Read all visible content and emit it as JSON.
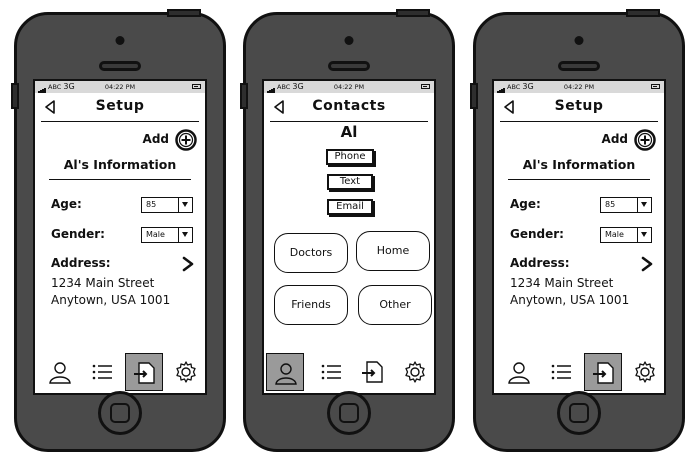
{
  "status": {
    "carrier": "ABC",
    "network": "3G",
    "time": "04:22 PM"
  },
  "setup": {
    "title": "Setup",
    "add_label": "Add",
    "section_title": "Al's Information",
    "age_label": "Age:",
    "age_value": "85",
    "gender_label": "Gender:",
    "gender_value": "Male",
    "address_label": "Address:",
    "address_line1": "1234 Main Street",
    "address_line2": "Anytown, USA 1001"
  },
  "contacts": {
    "title": "Contacts",
    "name": "Al",
    "actions": [
      "Phone",
      "Text",
      "Email"
    ],
    "groups": [
      "Doctors",
      "Home",
      "Friends",
      "Other"
    ]
  },
  "tabbar": {
    "tabs": [
      "user-icon",
      "list-icon",
      "import-icon",
      "gear-icon"
    ],
    "active_bg": "#9a9a9a"
  }
}
